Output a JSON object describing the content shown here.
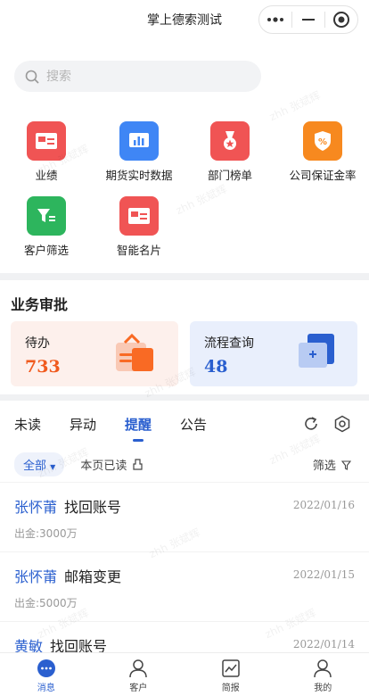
{
  "header": {
    "title": "掌上德索测试"
  },
  "capsule": {
    "more_icon": "more-dots-icon",
    "minimize_icon": "minimize-icon",
    "close_icon": "close-target-icon"
  },
  "search": {
    "placeholder": "搜索"
  },
  "apps": [
    {
      "label": "业绩",
      "color": "#f05454",
      "icon": "card-icon"
    },
    {
      "label": "期货实时数据",
      "color": "#3f86f5",
      "icon": "bar-chart-icon"
    },
    {
      "label": "部门榜单",
      "color": "#f05454",
      "icon": "medal-icon"
    },
    {
      "label": "公司保证金率",
      "color": "#f7891f",
      "icon": "shield-percent-icon"
    },
    {
      "label": "客户筛选",
      "color": "#2db55d",
      "icon": "funnel-icon"
    },
    {
      "label": "智能名片",
      "color": "#f05454",
      "icon": "card-icon"
    }
  ],
  "approval": {
    "title": "业务审批",
    "cards": [
      {
        "label": "待办",
        "count": "733",
        "color": "#f05a1e",
        "bg": "#fdf0ec"
      },
      {
        "label": "流程查询",
        "count": "48",
        "color": "#2a5fcf",
        "bg": "#e9effc"
      }
    ]
  },
  "messages": {
    "tabs": [
      "未读",
      "异动",
      "提醒",
      "公告"
    ],
    "active_tab": "提醒",
    "all_label": "全部",
    "read_all_label": "本页已读",
    "filter_label": "筛选",
    "items": [
      {
        "name": "张怀莆",
        "subject": "找回账号",
        "date": "2022/01/16",
        "amount": "出金:3000万"
      },
      {
        "name": "张怀莆",
        "subject": "邮箱变更",
        "date": "2022/01/15",
        "amount": "出金:5000万"
      },
      {
        "name": "黄敏",
        "subject": "找回账号",
        "date": "2022/01/14",
        "amount": ""
      }
    ]
  },
  "tabbar": [
    {
      "label": "消息",
      "icon": "chat-icon",
      "active": true
    },
    {
      "label": "客户",
      "icon": "person-icon",
      "active": false
    },
    {
      "label": "简报",
      "icon": "trend-chart-icon",
      "active": false
    },
    {
      "label": "我的",
      "icon": "user-icon",
      "active": false
    }
  ],
  "watermark": "zhh 张斌辉",
  "accent": "#2a5fcf"
}
